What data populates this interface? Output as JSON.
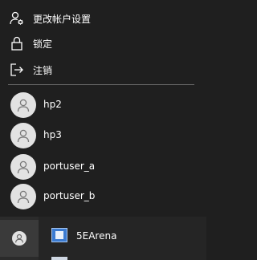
{
  "menu": {
    "items": [
      {
        "label": "更改帐户设置",
        "icon": "account-settings-icon"
      },
      {
        "label": "锁定",
        "icon": "lock-icon"
      },
      {
        "label": "注销",
        "icon": "sign-out-icon"
      }
    ]
  },
  "users": [
    {
      "name": "hp2",
      "icon": "user-avatar-icon"
    },
    {
      "name": "hp3",
      "icon": "user-avatar-icon"
    },
    {
      "name": "portuser_a",
      "icon": "user-avatar-icon"
    },
    {
      "name": "portuser_b",
      "icon": "user-avatar-icon"
    }
  ],
  "start": {
    "app": {
      "label": "5EArena",
      "icon": "app-window-icon"
    }
  },
  "colors": {
    "background": "#1f1f1f",
    "avatar": "#e2e2e2",
    "avatar_glyph": "#8a8a8a",
    "divider": "#6a6a6a"
  }
}
